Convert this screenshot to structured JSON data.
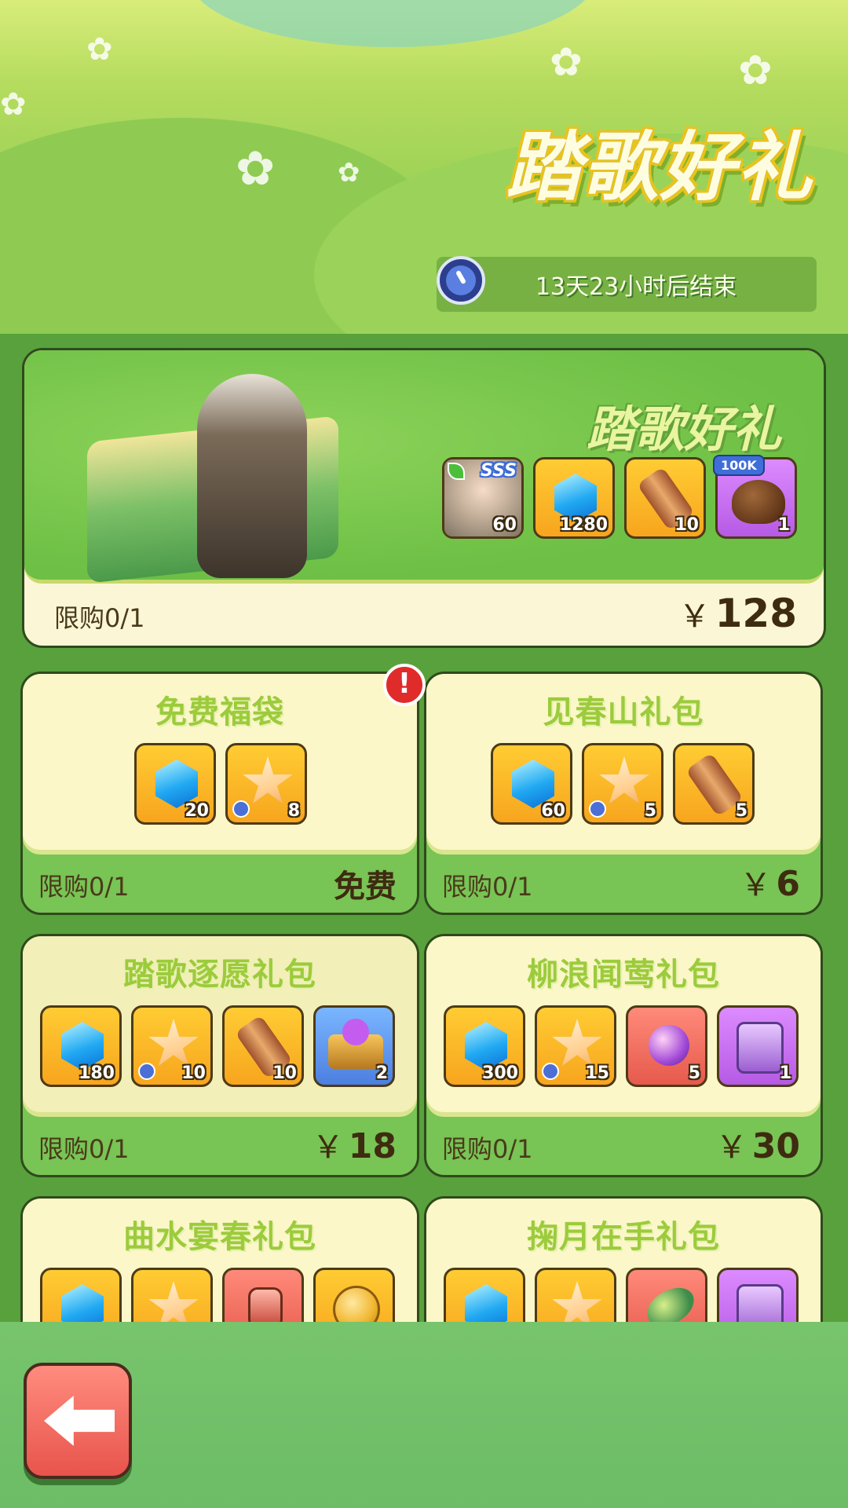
{
  "header": {
    "title": "踏歌好礼",
    "timer": "13天23小时后结束",
    "timer_icon": "clock-icon"
  },
  "featured": {
    "title": "踏歌好礼",
    "limit": "限购0/1",
    "currency": "￥",
    "price": "128",
    "items": [
      {
        "icon": "hero-portrait-icon",
        "badge": "SSS",
        "qty": "60",
        "color": "hero"
      },
      {
        "icon": "diamond-icon",
        "qty": "1280",
        "color": "gold"
      },
      {
        "icon": "scroll-icon",
        "qty": "10",
        "color": "gold"
      },
      {
        "icon": "coin-bag-icon",
        "tag": "100K",
        "qty": "1",
        "color": "purple"
      }
    ]
  },
  "packs": [
    {
      "title": "免费福袋",
      "limit": "限购0/1",
      "price_text": "免费",
      "alert": "!",
      "items": [
        {
          "icon": "diamond-icon",
          "qty": "20",
          "color": "gold"
        },
        {
          "icon": "timed-star-icon",
          "qty": "8",
          "color": "gold"
        }
      ]
    },
    {
      "title": "见春山礼包",
      "limit": "限购0/1",
      "currency": "￥",
      "price": "6",
      "items": [
        {
          "icon": "diamond-icon",
          "qty": "60",
          "color": "gold"
        },
        {
          "icon": "timed-star-icon",
          "qty": "5",
          "color": "gold"
        },
        {
          "icon": "scroll-icon",
          "qty": "5",
          "color": "gold"
        }
      ]
    },
    {
      "title": "踏歌逐愿礼包",
      "limit": "限购0/1",
      "currency": "￥",
      "price": "18",
      "items": [
        {
          "icon": "diamond-icon",
          "qty": "180",
          "color": "gold"
        },
        {
          "icon": "timed-star-icon",
          "qty": "10",
          "color": "gold"
        },
        {
          "icon": "scroll-icon",
          "qty": "10",
          "color": "gold"
        },
        {
          "icon": "treasure-chest-icon",
          "qty": "2",
          "color": "blue"
        }
      ]
    },
    {
      "title": "柳浪闻莺礼包",
      "limit": "限购0/1",
      "currency": "￥",
      "price": "30",
      "items": [
        {
          "icon": "diamond-icon",
          "qty": "300",
          "color": "gold"
        },
        {
          "icon": "timed-star-icon",
          "qty": "15",
          "color": "gold"
        },
        {
          "icon": "purple-scroll-icon",
          "qty": "5",
          "color": "red"
        },
        {
          "icon": "stone-tablet-icon",
          "qty": "1",
          "color": "purple"
        }
      ]
    },
    {
      "title": "曲水宴春礼包",
      "items": [
        {
          "icon": "diamond-icon",
          "color": "gold"
        },
        {
          "icon": "star-icon",
          "color": "gold"
        },
        {
          "icon": "potion-icon",
          "color": "red"
        },
        {
          "icon": "gold-coin-icon",
          "color": "gold"
        }
      ]
    },
    {
      "title": "掬月在手礼包",
      "items": [
        {
          "icon": "diamond-icon",
          "color": "gold"
        },
        {
          "icon": "star-icon",
          "color": "gold"
        },
        {
          "icon": "bean-pod-icon",
          "color": "red"
        },
        {
          "icon": "stone-tablet-icon",
          "color": "purple"
        }
      ]
    }
  ],
  "footer": {
    "back_icon": "back-arrow-icon"
  }
}
